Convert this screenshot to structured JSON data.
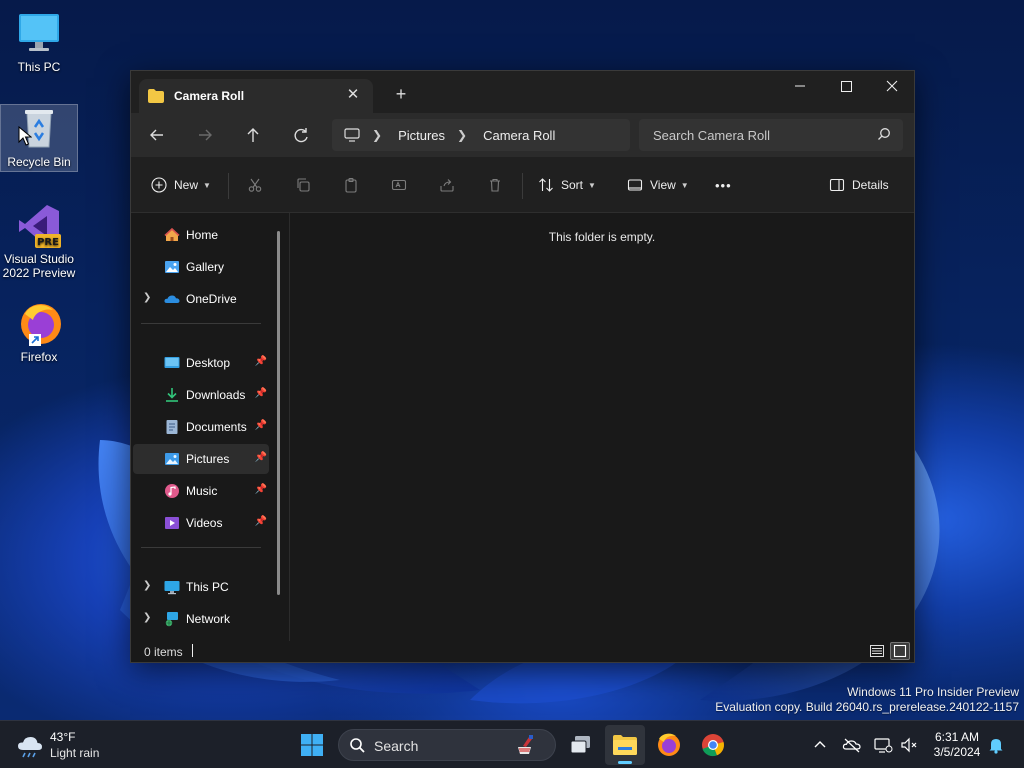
{
  "desktop": {
    "icons": [
      {
        "label": "This PC"
      },
      {
        "label": "Recycle Bin"
      },
      {
        "label": "Visual Studio 2022 Preview"
      },
      {
        "label": "Firefox"
      }
    ]
  },
  "window": {
    "tab_title": "Camera Roll",
    "new_tab_glyph": "+",
    "close_tab_glyph": "✕",
    "controls": {
      "minimize": "—",
      "maximize": "☐",
      "close": "✕"
    },
    "address_segments": [
      "Pictures",
      "Camera Roll"
    ],
    "search_placeholder": "Search Camera Roll",
    "commands": {
      "new": "New",
      "sort": "Sort",
      "view": "View",
      "more": "•••",
      "details": "Details"
    },
    "sidebar": {
      "top": [
        {
          "label": "Home",
          "icon": "home-icon"
        },
        {
          "label": "Gallery",
          "icon": "gallery-icon"
        },
        {
          "label": "OneDrive",
          "icon": "onedrive-icon"
        }
      ],
      "pinned": [
        {
          "label": "Desktop",
          "icon": "desktop-folder-icon"
        },
        {
          "label": "Downloads",
          "icon": "downloads-icon"
        },
        {
          "label": "Documents",
          "icon": "documents-icon"
        },
        {
          "label": "Pictures",
          "icon": "pictures-icon",
          "selected": true
        },
        {
          "label": "Music",
          "icon": "music-icon"
        },
        {
          "label": "Videos",
          "icon": "videos-icon"
        }
      ],
      "bottom": [
        {
          "label": "This PC",
          "icon": "this-pc-icon"
        },
        {
          "label": "Network",
          "icon": "network-icon"
        }
      ]
    },
    "empty_message": "This folder is empty.",
    "status": {
      "items": "0 items"
    }
  },
  "watermark": {
    "line1": "Windows 11 Pro Insider Preview",
    "line2": "Evaluation copy. Build 26040.rs_prerelease.240122-1157"
  },
  "taskbar": {
    "weather": {
      "temp": "43°F",
      "condition": "Light rain"
    },
    "search_label": "Search",
    "clock": {
      "time": "6:31 AM",
      "date": "3/5/2024"
    }
  },
  "colors": {
    "accent": "#60cdff",
    "folder": "#f2c744",
    "window_bg": "#191919"
  }
}
